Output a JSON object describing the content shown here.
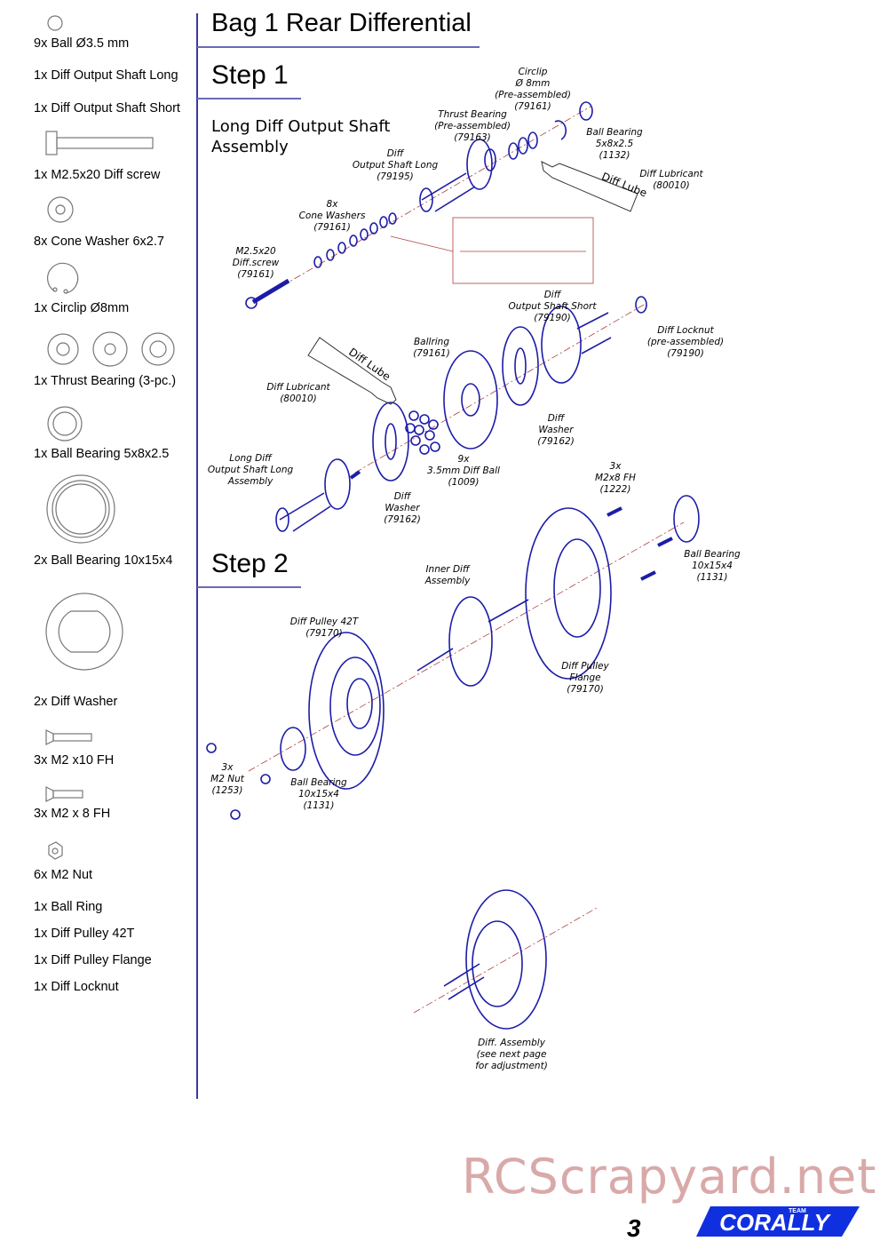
{
  "title": "Bag 1 Rear Differential",
  "step1": {
    "heading": "Step 1",
    "subtitle": "Long Diff Output Shaft\nAssembly"
  },
  "step2": {
    "heading": "Step 2"
  },
  "parts_list": [
    "9x Ball Ø3.5 mm",
    "1x  Diff Output Shaft Long",
    "1x  Diff Output Shaft Short",
    "1x  M2.5x20 Diff screw",
    "8x  Cone Washer 6x2.7",
    "1x  Circlip Ø8mm",
    "1x  Thrust Bearing (3-pc.)",
    "1x  Ball Bearing 5x8x2.5",
    "2x  Ball Bearing 10x15x4",
    "2x  Diff Washer",
    "3x  M2 x10 FH",
    "3x  M2 x 8 FH",
    "6x  M2 Nut",
    "1x  Ball Ring",
    "1x  Diff Pulley 42T",
    "1x  Diff Pulley Flange",
    "1x  Diff Locknut"
  ],
  "callouts": [
    "Circlip\nØ 8mm\n(Pre-assembled)\n(79161)",
    "Thrust Bearing\n(Pre-assembled)\n(79163)",
    "Ball Bearing\n5x8x2.5\n(1132)",
    "Diff Lubricant\n(80010)",
    "Diff\nOutput Shaft Long\n(79195)",
    "8x\nCone Washers\n(79161)",
    "M2.5x20\nDiff.screw\n(79161)",
    "Diff\nOutput Shaft Short\n(79190)",
    "Diff Locknut\n(pre-assembled)\n(79190)",
    "Ballring\n(79161)",
    "Diff Lubricant\n(80010)",
    "Diff\nWasher\n(79162)",
    "Long Diff\nOutput Shaft Long\nAssembly",
    "9x\n3.5mm Diff Ball\n(1009)",
    "Diff\nWasher\n(79162)",
    "3x\nM2x8 FH\n(1222)",
    "Ball Bearing\n10x15x4\n(1131)",
    "Inner Diff\nAssembly",
    "Diff Pulley 42T\n(79170)",
    "Diff Pulley\nFlange\n(79170)",
    "3x\nM2 Nut\n(1253)",
    "Ball Bearing\n10x15x4\n(1131)",
    "Diff. Assembly\n(see next page\nfor adjustment)"
  ],
  "tube_label": "Diff Lube",
  "watermark": "RCScrapyard.net",
  "page_number": "3",
  "logo_text": "TEAM CORALLY",
  "colors": {
    "line_art": "#1c1ca8",
    "axis": "#b04040",
    "heading_rule": "#6a6ab8",
    "watermark": "#d9a9a9",
    "logo": "#1030e0"
  }
}
